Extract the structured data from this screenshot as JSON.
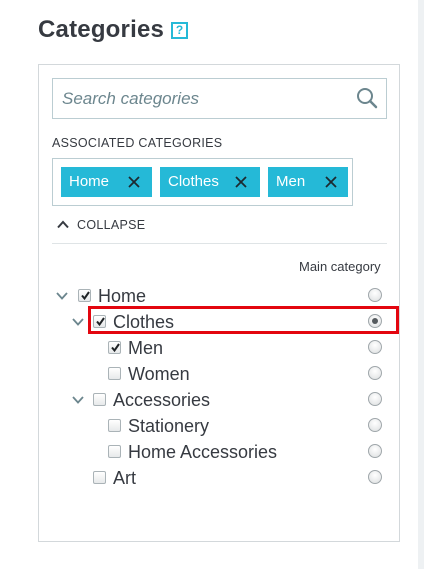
{
  "header": {
    "title": "Categories",
    "help_label": "?"
  },
  "search": {
    "placeholder": "Search categories",
    "icon": "search-icon"
  },
  "associated": {
    "label": "ASSOCIATED CATEGORIES",
    "tags": [
      "Home",
      "Clothes",
      "Men"
    ]
  },
  "collapse": {
    "label": "COLLAPSE"
  },
  "tree": {
    "main_category_label": "Main category",
    "nodes": [
      {
        "label": "Home",
        "checked": true,
        "expanded": true,
        "main": false
      },
      {
        "label": "Clothes",
        "checked": true,
        "expanded": true,
        "main": true
      },
      {
        "label": "Men",
        "checked": true,
        "main": false
      },
      {
        "label": "Women",
        "checked": false,
        "main": false
      },
      {
        "label": "Accessories",
        "checked": false,
        "expanded": true,
        "main": false
      },
      {
        "label": "Stationery",
        "checked": false,
        "main": false
      },
      {
        "label": "Home Accessories",
        "checked": false,
        "main": false
      },
      {
        "label": "Art",
        "checked": false,
        "main": false
      }
    ]
  },
  "colors": {
    "accent": "#25b9d7",
    "highlight": "#e3060f",
    "text": "#363a41",
    "muted": "#6c868e"
  }
}
